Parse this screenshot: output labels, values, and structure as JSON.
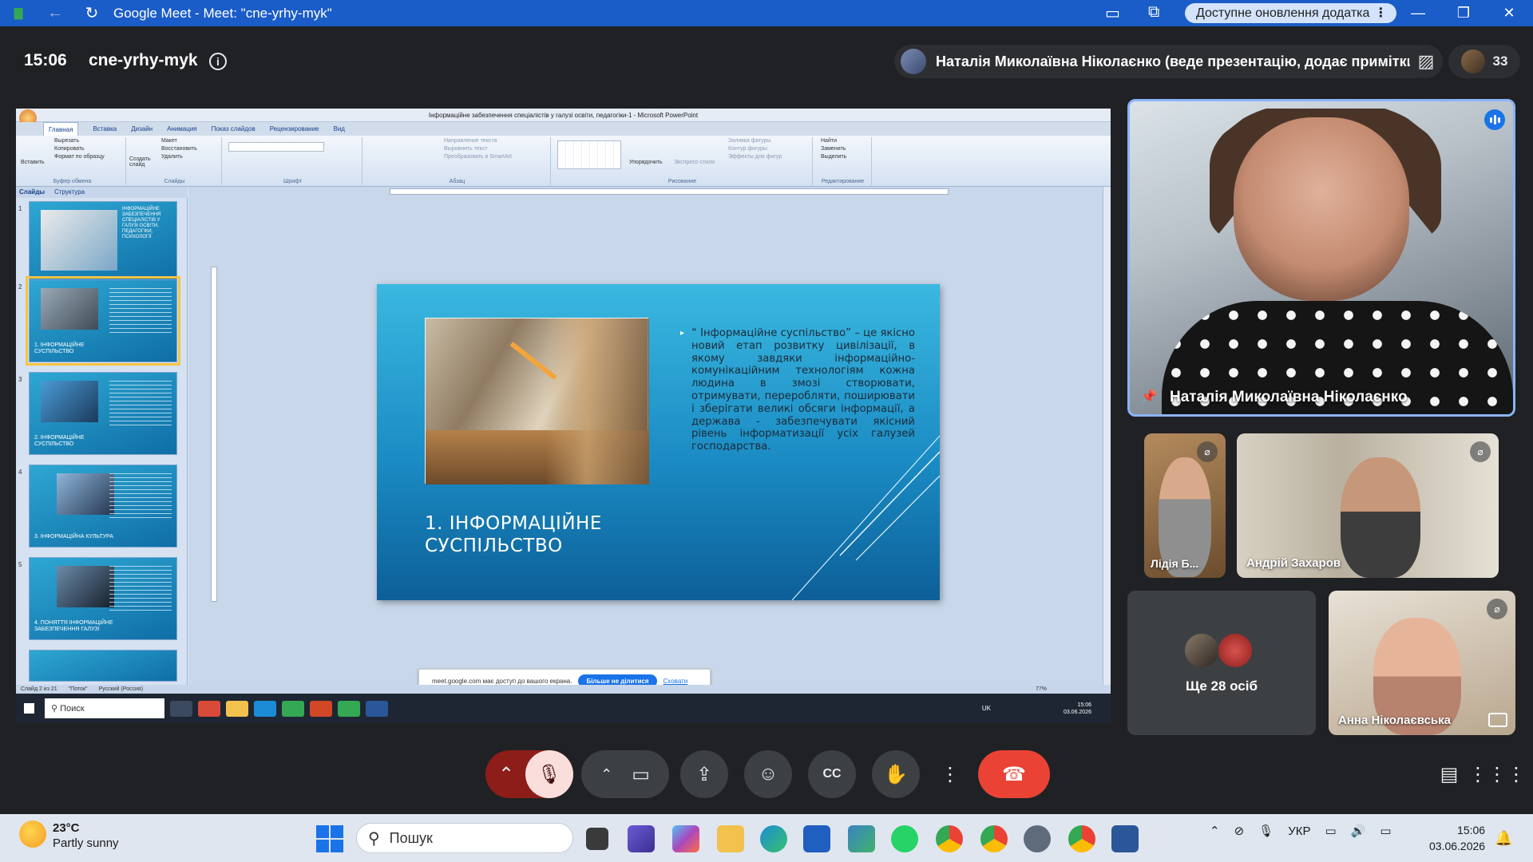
{
  "window": {
    "title": "Google Meet - Meet: \"cne-yrhy-myk\"",
    "update_label": "Доступне оновлення додатка",
    "update_more": "⋮",
    "min": "—",
    "restore": "❐",
    "close": "✕"
  },
  "meeting": {
    "time": "15:06",
    "code": "cne-yrhy-myk",
    "presenter_label": "Наталія Миколаївна Ніколаєнко (веде презентацію, додає примітки)",
    "participant_count": "33"
  },
  "powerpoint": {
    "title": "Інформаційне забезпечення спеціалістів у галузі освіти, педагогіки-1 - Microsoft PowerPoint",
    "tabs": [
      "Главная",
      "Вставка",
      "Дизайн",
      "Анимация",
      "Показ слайдов",
      "Рецензирование",
      "Вид"
    ],
    "ribbon": {
      "clipboard": [
        "Вырезать",
        "Копировать",
        "Формат по образцу"
      ],
      "clipboard_group": "Буфер обмена",
      "paste": "Вставить",
      "slides": [
        "Макет",
        "Восстановить",
        "Удалить"
      ],
      "new_slide": "Создать слайд",
      "slides_group": "Слайды",
      "font_group": "Шрифт",
      "paragraph": [
        "Направление текста",
        "Выровнять текст",
        "Преобразовать в SmartArt"
      ],
      "paragraph_group": "Абзац",
      "drawing": [
        "Заливка фигуры",
        "Контур фигуры",
        "Эффекты для фигур"
      ],
      "arrange": "Упорядочить",
      "quick_styles": "Экспресс-стили",
      "drawing_group": "Рисование",
      "editing": [
        "Найти",
        "Заменить",
        "Выделить"
      ],
      "editing_group": "Редактирование"
    },
    "panel_tabs": [
      "Слайды",
      "Структура"
    ],
    "thumbnails": [
      {
        "num": "1",
        "title": ""
      },
      {
        "num": "2",
        "title": "1. ІНФОРМАЦІЙНЕ СУСПІЛЬСТВО"
      },
      {
        "num": "3",
        "title": "2. ІНФОРМАЦІЙНЕ СУСПІЛЬСТВО"
      },
      {
        "num": "4",
        "title": "3. ІНФОРМАЦІЙНА КУЛЬТУРА"
      },
      {
        "num": "5",
        "title": "4. ПОНЯТТЯ ІНФОРМАЦІЙНЕ ЗАБЕЗПЕЧЕННЯ ГАЛУЗІ"
      }
    ],
    "thumb1_text": "ІНФОРМАЦІЙНЕ ЗАБЕЗПЕЧЕННЯ СПЕЦІАЛІСТІВ У ГАЛУЗІ ОСВІТИ, ПЕДАГОГІКИ, ПСИХОЛОГІЇ",
    "slide": {
      "heading": "1. ІНФОРМАЦІЙНЕ СУСПІЛЬСТВО",
      "body": "“ Інформаційне суспільство” – це якісно новий етап розвитку цивілізації, в якому завдяки інформаційно-комунікаційним технологіям кожна людина в змозі створювати, отримувати, переробляти, поширювати і зберігати великі обсяги інформації, а держава - забезпечувати якісний рівень інформатизації усіх галузей господарства."
    },
    "share_notice": "meet.google.com має доступ до вашого екрана.",
    "stop_sharing": "Більше не ділитися",
    "hide": "Сховати",
    "status": [
      "Слайд 2 из 21",
      "\"Поток\"",
      "Русский (Россия)"
    ],
    "zoom": "77%",
    "inner_search": "Поиск",
    "inner_lang": "UK",
    "inner_time": "15:06",
    "inner_date": "03.06.2026"
  },
  "participants": {
    "main": "Наталія Миколаївна Ніколаєнко",
    "lidia": "Лідія Б...",
    "andrii": "Андрій Захаров",
    "more": "Ще 28 осіб",
    "anna": "Анна Ніколаєвська"
  },
  "taskbar": {
    "temp": "23°C",
    "weather": "Partly sunny",
    "search": "Пошук",
    "lang": "УКР",
    "time": "15:06",
    "date": "03.06.2026"
  },
  "colors": {
    "meet_bg": "#202124",
    "accent": "#1a73e8",
    "end_call": "#ea4335",
    "slide_blue": "#1b8cc4"
  }
}
